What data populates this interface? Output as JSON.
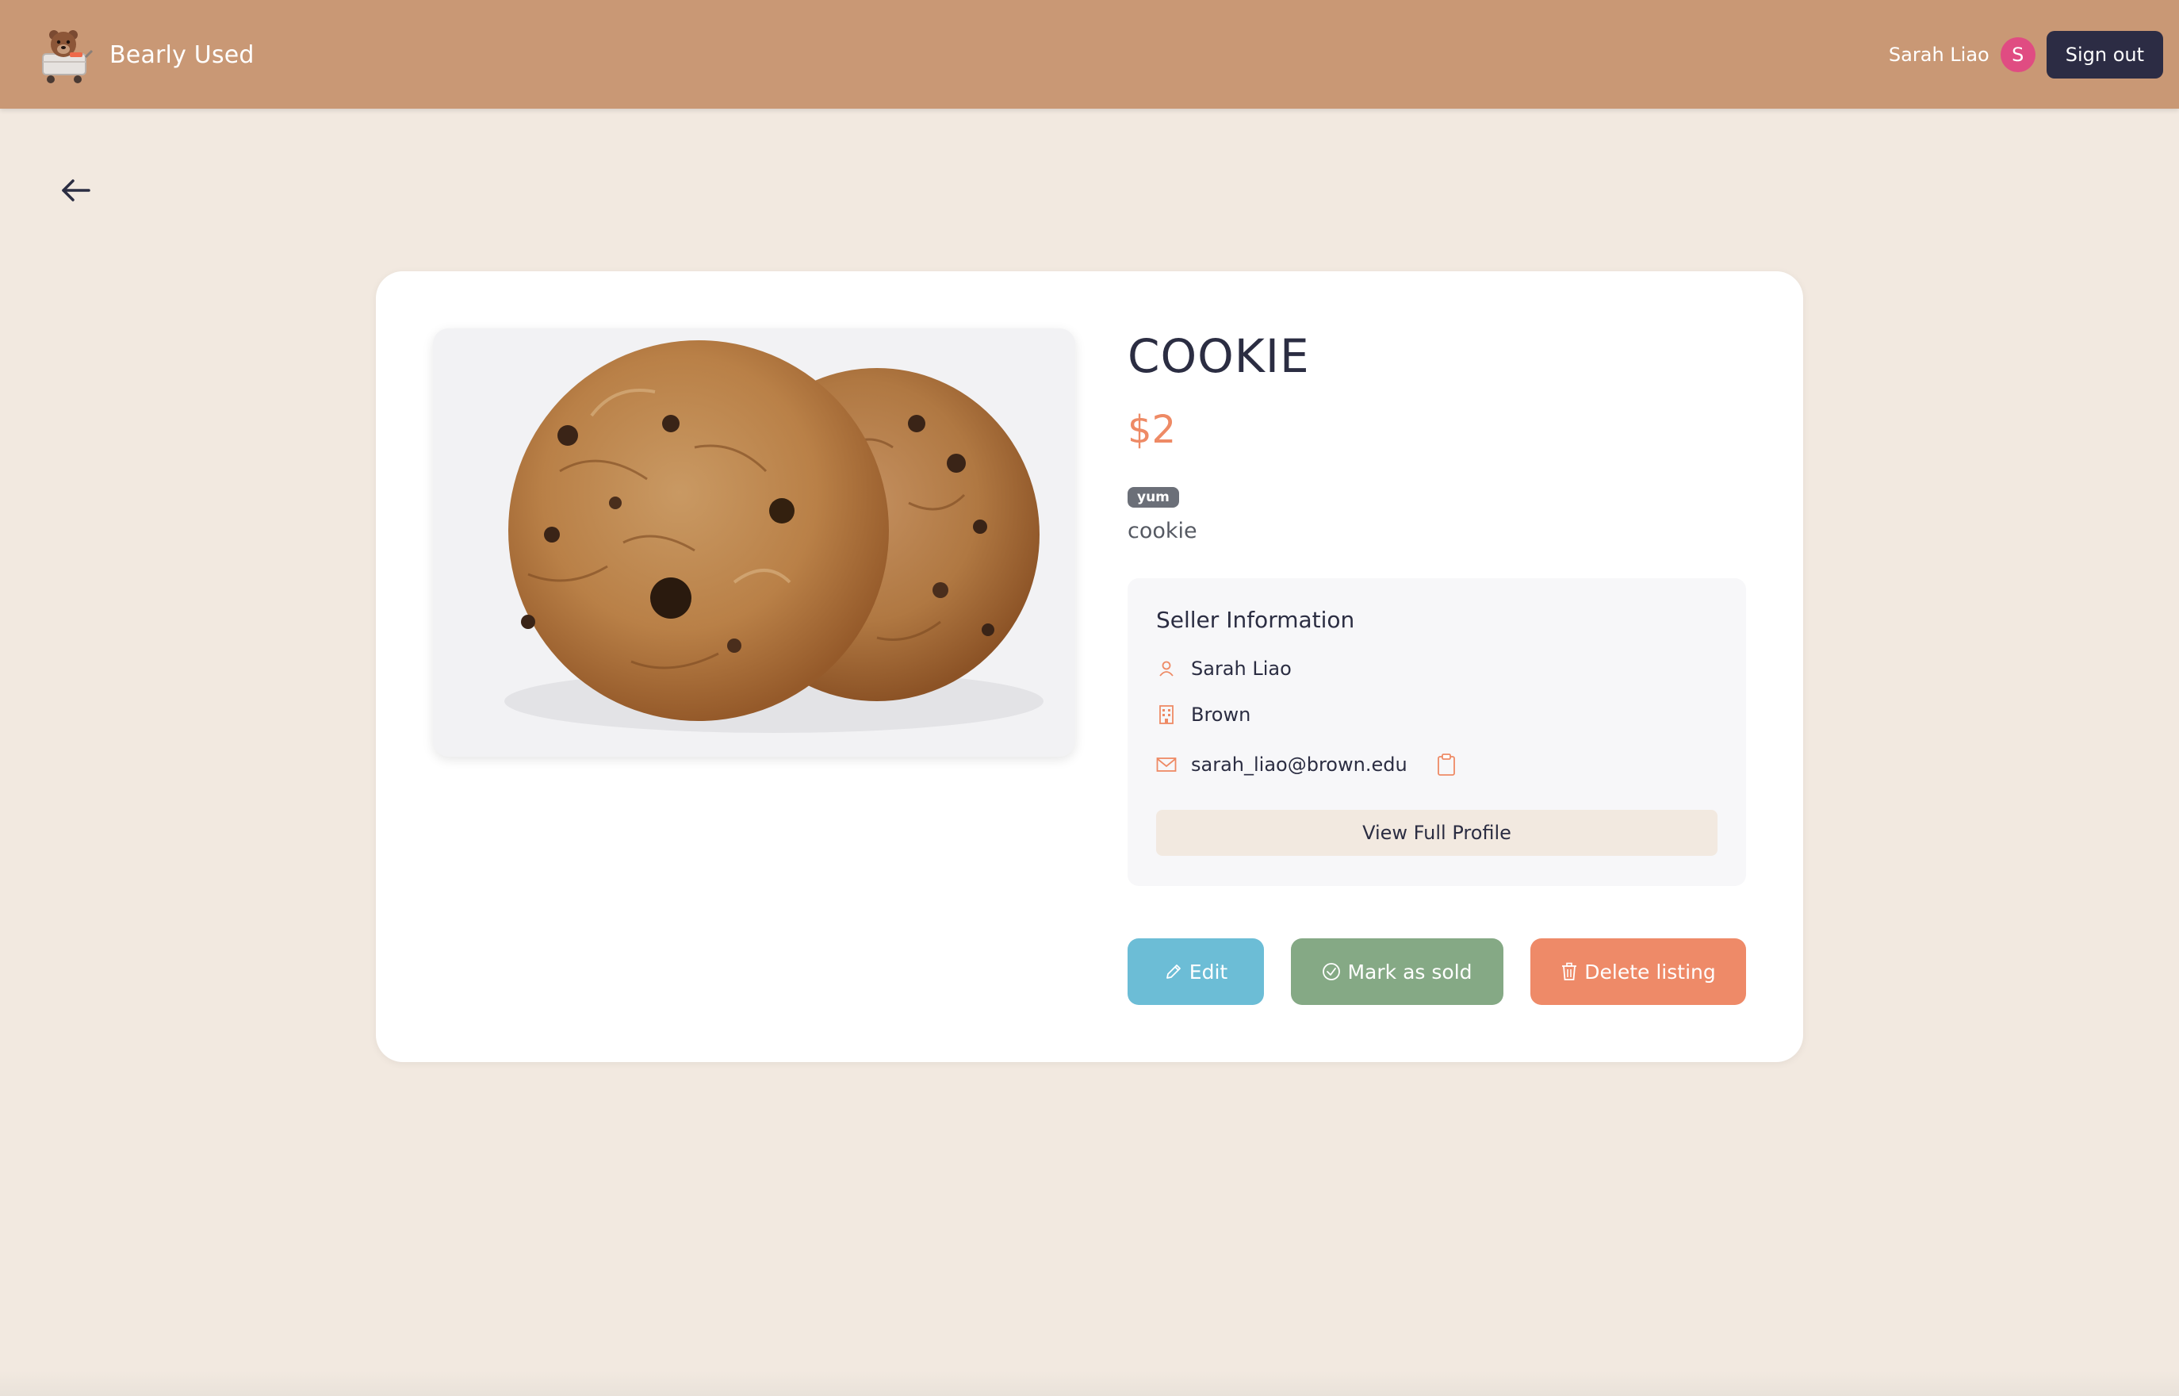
{
  "header": {
    "brand_name": "Bearly Used",
    "logo_icon": "bear-logo-icon",
    "user_name": "Sarah Liao",
    "avatar_initial": "S",
    "signout_label": "Sign out"
  },
  "nav": {
    "back_icon": "arrow-left-icon"
  },
  "listing": {
    "title": "COOKIE",
    "price": "$2",
    "tag": "yum",
    "description": "cookie",
    "image_icon": "cookie-photo"
  },
  "seller": {
    "heading": "Seller Information",
    "name": "Sarah Liao",
    "school": "Brown",
    "email": "sarah_liao@brown.edu",
    "view_profile_label": "View Full Profile",
    "icons": [
      "user-icon",
      "building-icon",
      "mail-icon",
      "clipboard-icon"
    ]
  },
  "actions": {
    "edit_label": "Edit",
    "sold_label": "Mark as sold",
    "delete_label": "Delete listing"
  },
  "colors": {
    "header_bg": "#c99875",
    "page_bg": "#f2e9e0",
    "accent": "#ee8a65",
    "edit": "#6cbdd6",
    "sold": "#85a985",
    "delete": "#ee8a68",
    "signout": "#2c2c44",
    "avatar": "#e04c82"
  }
}
